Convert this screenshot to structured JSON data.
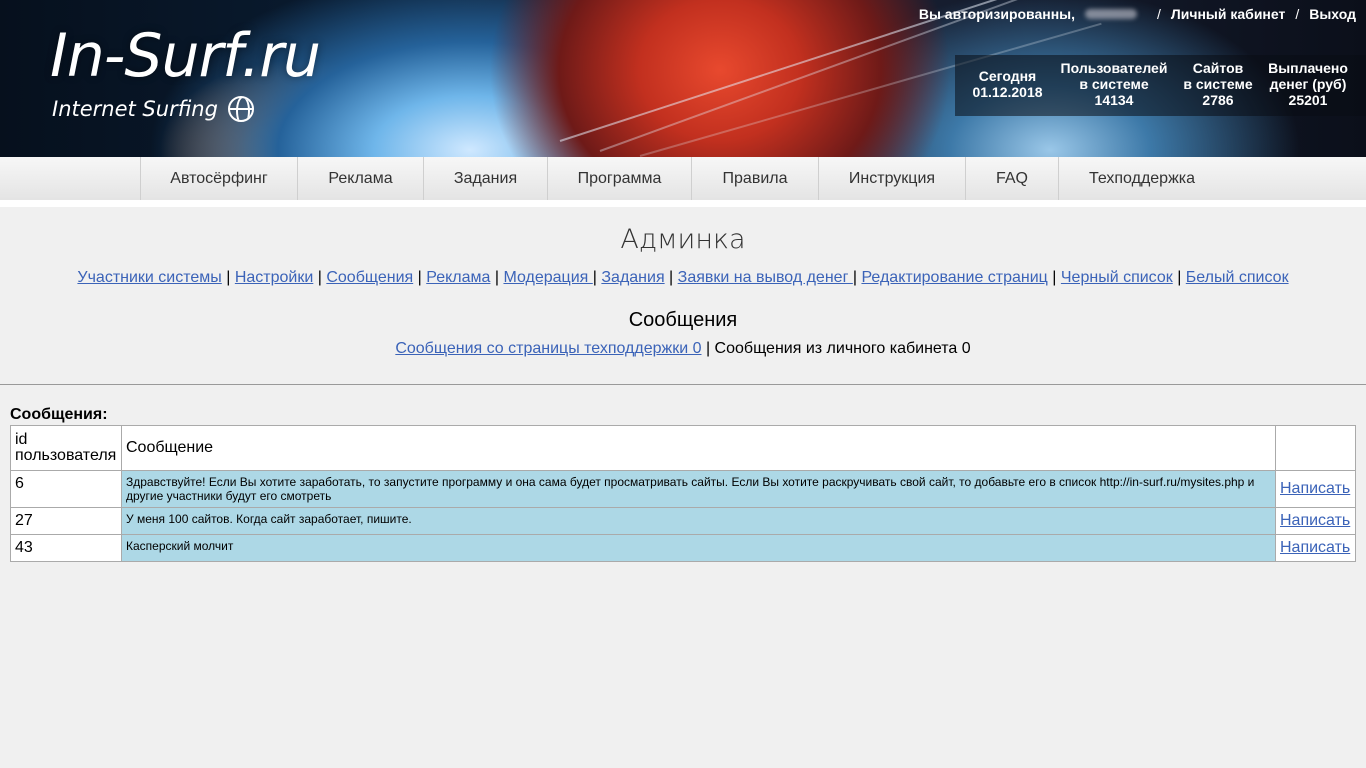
{
  "site": {
    "logo": "In-Surf.ru",
    "tagline": "Internet Surfing"
  },
  "top_bar": {
    "auth_text": "Вы авторизированны,",
    "separator": "/",
    "cabinet_link": "Личный кабинет",
    "logout_link": "Выход"
  },
  "stats": {
    "today": {
      "label": "Сегодня",
      "value": "01.12.2018"
    },
    "users": {
      "label1": "Пользователей",
      "label2": "в системе",
      "value": "14134"
    },
    "sites": {
      "label1": "Сайтов",
      "label2": "в системе",
      "value": "2786"
    },
    "paid": {
      "label1": "Выплачено",
      "label2": "денег (руб)",
      "value": "25201"
    }
  },
  "nav": {
    "items": [
      "Автосёрфинг",
      "Реклама",
      "Задания",
      "Программа",
      "Правила",
      "Инструкция",
      "FAQ",
      "Техподдержка"
    ]
  },
  "admin": {
    "title": "Админка",
    "links": [
      "Участники системы",
      "Настройки",
      "Сообщения",
      "Реклама",
      "Модерация ",
      "Задания",
      "Заявки на вывод денег ",
      "Редактирование страниц",
      "Черный список",
      "Белый список"
    ],
    "sep": " | "
  },
  "messages_section": {
    "title": "Сообщения",
    "support_link": "Сообщения со страницы техподдержки 0",
    "cabinet_text": "Сообщения из личного кабинета 0",
    "sep": " | "
  },
  "table": {
    "label": "Сообщения:",
    "col_id": "id пользователя",
    "col_message": "Сообщение",
    "action_label": "Написать",
    "rows": [
      {
        "id": "6",
        "message": "Здравствуйте! Если Вы хотите заработать, то запустите программу и она сама будет просматривать сайты. Если Вы хотите раскручивать свой сайт, то добавьте его в список http://in-surf.ru/mysites.php и другие участники будут его смотреть"
      },
      {
        "id": "27",
        "message": "У меня 100 сайтов. Когда сайт заработает, пишите."
      },
      {
        "id": "43",
        "message": "Касперский молчит"
      }
    ]
  }
}
